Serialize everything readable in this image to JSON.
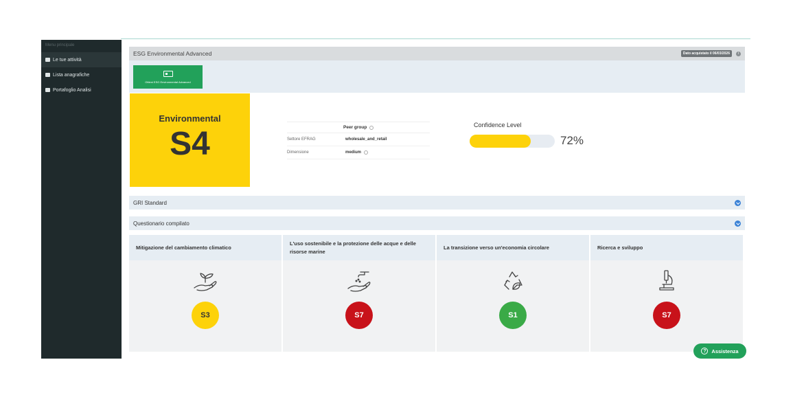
{
  "sidebar": {
    "header": "Menu principale",
    "items": [
      {
        "label": "Le tue attività",
        "icon": "list-icon"
      },
      {
        "label": "Lista anagrafiche",
        "icon": "book-icon"
      },
      {
        "label": "Portafoglio Analisi",
        "icon": "folder-icon"
      }
    ]
  },
  "header": {
    "title": "ESG Environmental Advanced",
    "badge": "Dato acquistato il 06/03/2026"
  },
  "action": {
    "button_label": "Ottieni ESG Environmental Advanced"
  },
  "environmental": {
    "label": "Environmental",
    "score": "S4",
    "color": "#fdd20a"
  },
  "peer_group": {
    "title": "Peer group",
    "rows": [
      {
        "key": "Settore EFRAG",
        "value": "wholesale_and_retail"
      },
      {
        "key": "Dimensione",
        "value": "medium"
      }
    ]
  },
  "confidence": {
    "title": "Confidence Level",
    "value_text": "72%",
    "value": 0.72
  },
  "accordions": [
    {
      "label": "GRI Standard"
    },
    {
      "label": "Questionario compilato"
    }
  ],
  "categories": [
    {
      "title": "Mitigazione del cambiamento climatico",
      "icon": "hand-plant-icon",
      "score": "S3",
      "color": "#fdd20a"
    },
    {
      "title": "L'uso sostenibile e la protezione delle acque e delle risorse marine",
      "icon": "water-tap-hand-icon",
      "score": "S7",
      "color": "#c8121a"
    },
    {
      "title": "La transizione verso un'economia circolare",
      "icon": "recycle-leaf-icon",
      "score": "S1",
      "color": "#3aaa47"
    },
    {
      "title": "Ricerca e sviluppo",
      "icon": "microscope-icon",
      "score": "S7",
      "color": "#c8121a"
    }
  ],
  "help": {
    "label": "Assistenza"
  }
}
